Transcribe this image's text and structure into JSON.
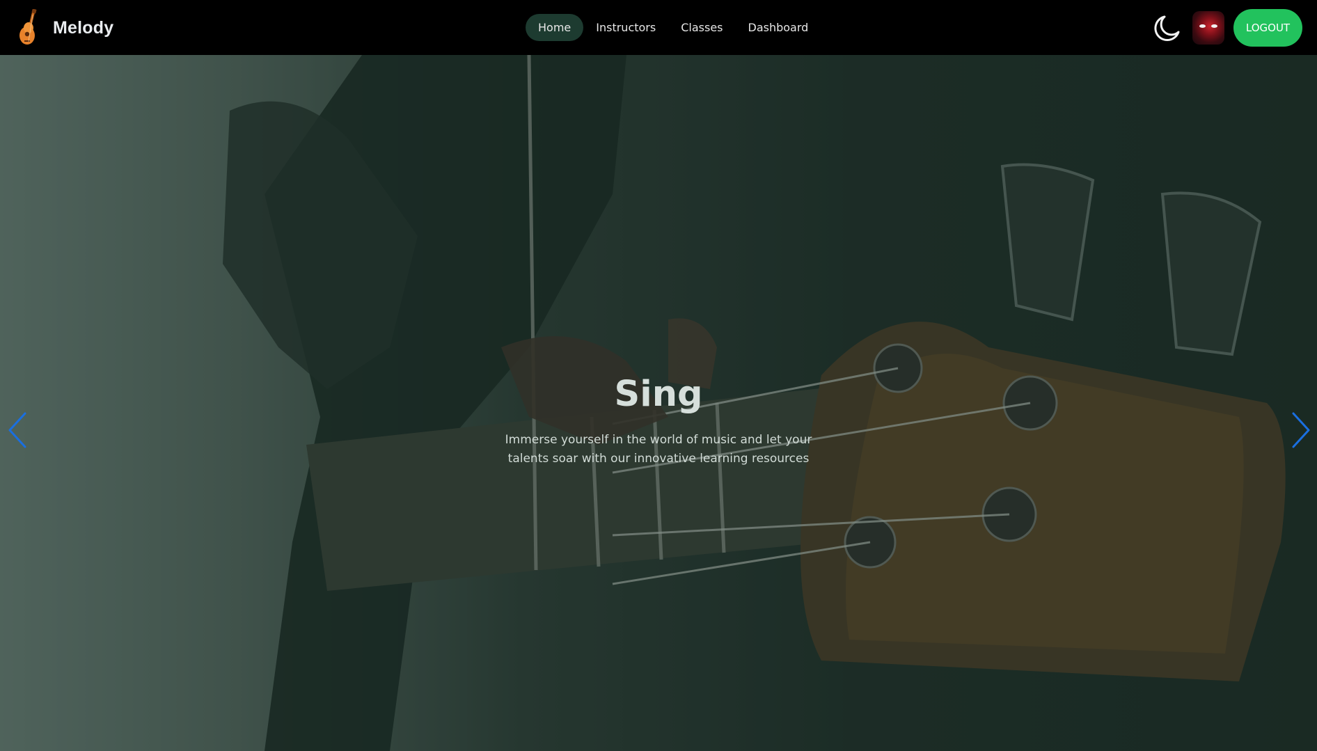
{
  "brand": {
    "name": "Melody",
    "logo_icon": "guitar-icon"
  },
  "nav": {
    "items": [
      {
        "label": "Home",
        "active": true
      },
      {
        "label": "Instructors",
        "active": false
      },
      {
        "label": "Classes",
        "active": false
      },
      {
        "label": "Dashboard",
        "active": false
      }
    ]
  },
  "actions": {
    "theme_toggle_icon": "moon-icon",
    "avatar_icon": "user-avatar",
    "logout_label": "LOGOUT"
  },
  "hero": {
    "title": "Sing",
    "subtitle": "Immerse yourself in the world of music and let your talents soar with our innovative learning resources",
    "prev_icon": "chevron-left-icon",
    "next_icon": "chevron-right-icon"
  },
  "colors": {
    "navbar_bg": "#000000",
    "active_nav_bg": "#1d3b30",
    "logout_bg": "#22c25d",
    "arrow_color": "#1a6fe0",
    "hero_overlay": "#162d24"
  }
}
